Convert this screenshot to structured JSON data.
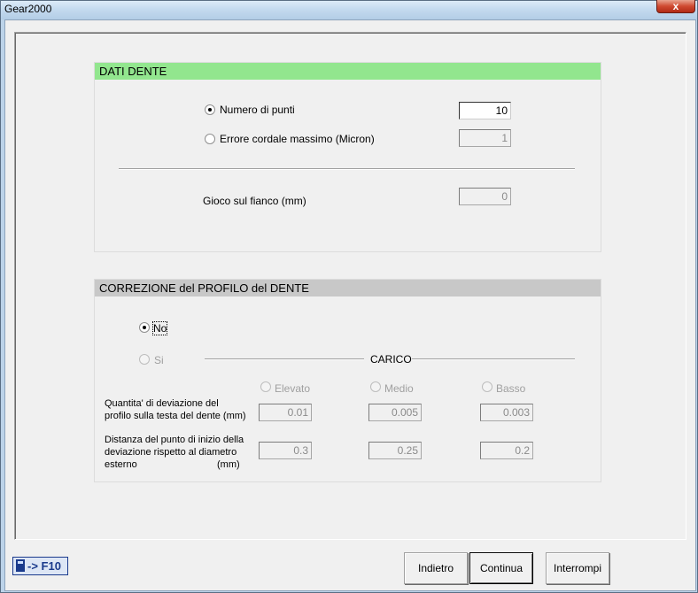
{
  "window": {
    "title": "Gear2000",
    "close_glyph": "x"
  },
  "dati_dente": {
    "header": "DATI DENTE",
    "header_color": "#92e68e",
    "numero_punti": {
      "label": "Numero di punti",
      "value": "10",
      "checked": true
    },
    "errore_cordale": {
      "label": "Errore cordale massimo (Micron)",
      "value": "1",
      "checked": false
    },
    "gioco": {
      "label": "Gioco sul fianco (mm)",
      "value": "0"
    }
  },
  "correzione": {
    "header": "CORREZIONE del PROFILO del DENTE",
    "header_color": "#c8c8c8",
    "no_label": "No",
    "si_label": "Si",
    "carico_label": "CARICO",
    "columns": [
      "Elevato",
      "Medio",
      "Basso"
    ],
    "row1_label": "Quantita' di deviazione del profilo sulla testa del dente (mm)",
    "row1_line1": "Quantita' di deviazione del",
    "row1_line2": "profilo sulla testa del dente (mm)",
    "row1_values": [
      "0.01",
      "0.005",
      "0.003"
    ],
    "row2_line1": "Distanza del punto di inizio della",
    "row2_line2": "deviazione rispetto al diametro",
    "row2_line3a": "esterno",
    "row2_line3b": "(mm)",
    "row2_values": [
      "0.3",
      "0.25",
      "0.2"
    ]
  },
  "footer": {
    "f10_label": "-> F10",
    "f10_icon": "calculator-icon",
    "buttons": {
      "indietro": "Indietro",
      "continua": "Continua",
      "interrompi": "Interrompi"
    }
  }
}
